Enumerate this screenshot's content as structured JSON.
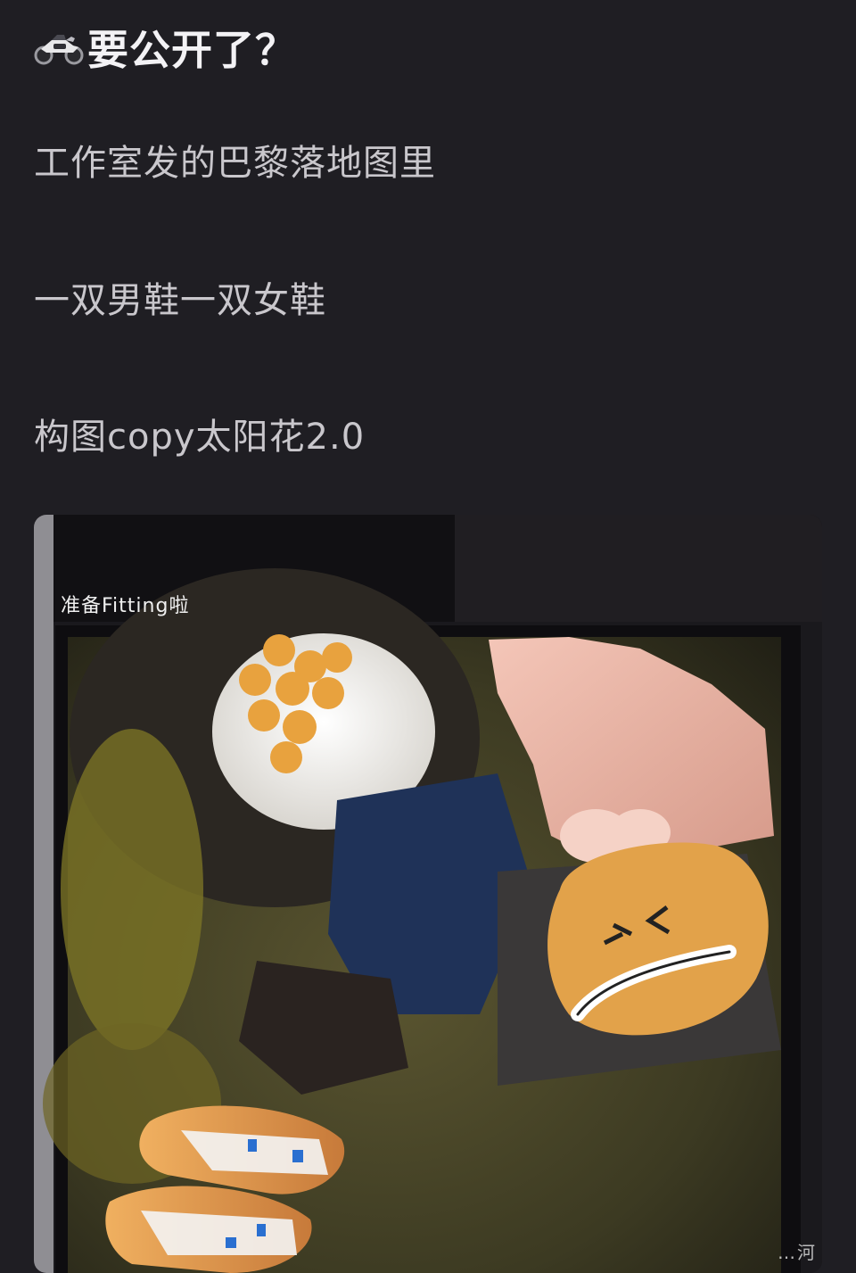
{
  "post": {
    "title": "要公开了？",
    "title_icon": "motorcycle-icon",
    "paragraphs": [
      "工作室发的巴黎落地图里",
      "一双男鞋一双女鞋",
      "构图copy太阳花2.0"
    ],
    "photo": {
      "caption": "准备Fitting啦"
    },
    "watermark": "…河"
  },
  "colors": {
    "background": "#1f1e23",
    "title": "#f3f2f5",
    "body_text": "#c9c7cc"
  }
}
